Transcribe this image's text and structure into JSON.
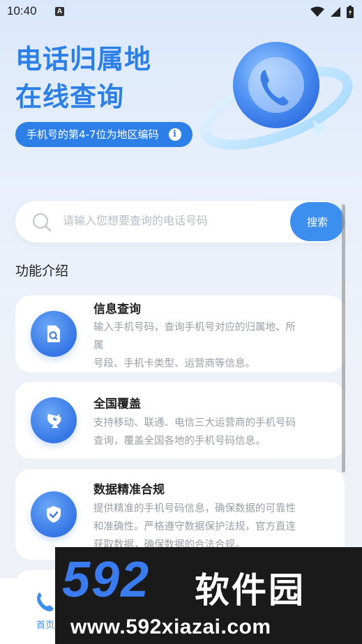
{
  "status_bar": {
    "time": "10:40",
    "notification_letter": "A"
  },
  "hero": {
    "title_line1": "电话归属地",
    "title_line2": "在线查询",
    "badge_text": "手机号的第4-7位为地区编码",
    "badge_info_glyph": "i"
  },
  "search": {
    "placeholder": "请输入您想要查询的电话号码",
    "button_label": "搜索"
  },
  "features": {
    "section_title": "功能介绍",
    "items": [
      {
        "title": "信息查询",
        "desc": [
          "输入手机号码，查询手机号对应的归属地、所",
          "属",
          "号段、手机卡类型、运营商等信息。"
        ],
        "icon": "document-search-icon"
      },
      {
        "title": "全国覆盖",
        "desc": [
          "支持移动、联通、电信三大运营商的手机号码",
          "查询，覆盖全国各地的手机号码信息。"
        ],
        "icon": "satellite-dish-icon"
      },
      {
        "title": "数据精准合规",
        "desc": [
          "提供精准的手机号码信息，确保数据的可靠性",
          "和准确性。严格遵守数据保护法规，官方直连",
          "获取数据，确保数据的合法合规。"
        ],
        "icon": "shield-check-icon"
      }
    ]
  },
  "bottom_nav": {
    "home_label": "首页"
  },
  "watermark": {
    "brand_digits": "592",
    "brand_cn": "软件园",
    "url": "www.592xiazai.com"
  },
  "colors": {
    "accent": "#3d8fef",
    "title_blue": "#2d7fe8"
  }
}
